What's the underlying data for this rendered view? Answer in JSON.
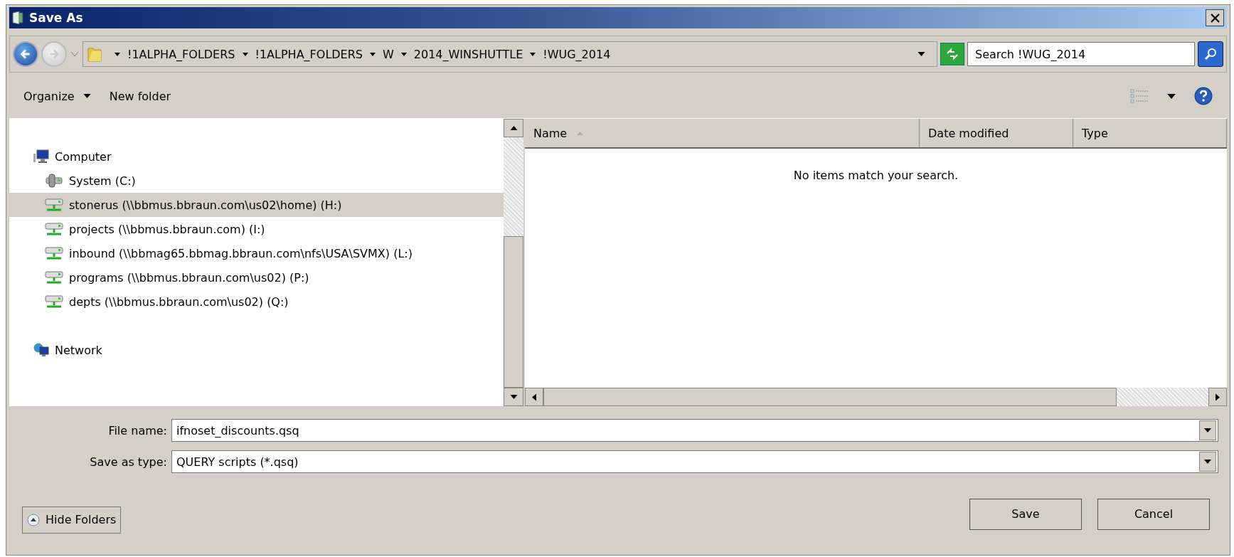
{
  "window": {
    "title": "Save As"
  },
  "address_bar": {
    "crumbs": [
      "!1ALPHA_FOLDERS",
      "!1ALPHA_FOLDERS",
      "W",
      "2014_WINSHUTTLE",
      "!WUG_2014"
    ]
  },
  "search": {
    "placeholder": "Search !WUG_2014"
  },
  "toolbar": {
    "items": [
      {
        "label": "Organize",
        "dropdown": true
      },
      {
        "label": "New folder",
        "dropdown": false
      }
    ]
  },
  "tree": [
    {
      "label": "Computer",
      "kind": "computer",
      "selected": false,
      "children": [
        {
          "label": "System (C:)",
          "kind": "local-drive",
          "selected": false
        },
        {
          "label": "stonerus (\\\\bbmus.bbraun.com\\us02\\home) (H:)",
          "kind": "network-drive",
          "selected": true
        },
        {
          "label": "projects (\\\\bbmus.bbraun.com) (I:)",
          "kind": "network-drive",
          "selected": false
        },
        {
          "label": "inbound (\\\\bbmag65.bbmag.bbraun.com\\nfs\\USA\\SVMX) (L:)",
          "kind": "network-drive",
          "selected": false
        },
        {
          "label": "programs (\\\\bbmus.bbraun.com\\us02) (P:)",
          "kind": "network-drive",
          "selected": false
        },
        {
          "label": "depts (\\\\bbmus.bbraun.com\\us02) (Q:)",
          "kind": "network-drive",
          "selected": false
        }
      ]
    },
    {
      "label": "Network",
      "kind": "network",
      "selected": false
    }
  ],
  "file_list": {
    "columns": [
      {
        "label": "Name",
        "sorted": true
      },
      {
        "label": "Date modified",
        "sorted": false
      },
      {
        "label": "Type",
        "sorted": false
      }
    ],
    "empty_message": "No items match your search."
  },
  "fields": [
    {
      "label": "File name:",
      "value": "ifnoset_discounts.qsq"
    },
    {
      "label": "Save as type:",
      "value": "QUERY scripts (*.qsq)"
    }
  ],
  "hide_folders": {
    "label": "Hide Folders"
  },
  "buttons": [
    "Save",
    "Cancel"
  ]
}
